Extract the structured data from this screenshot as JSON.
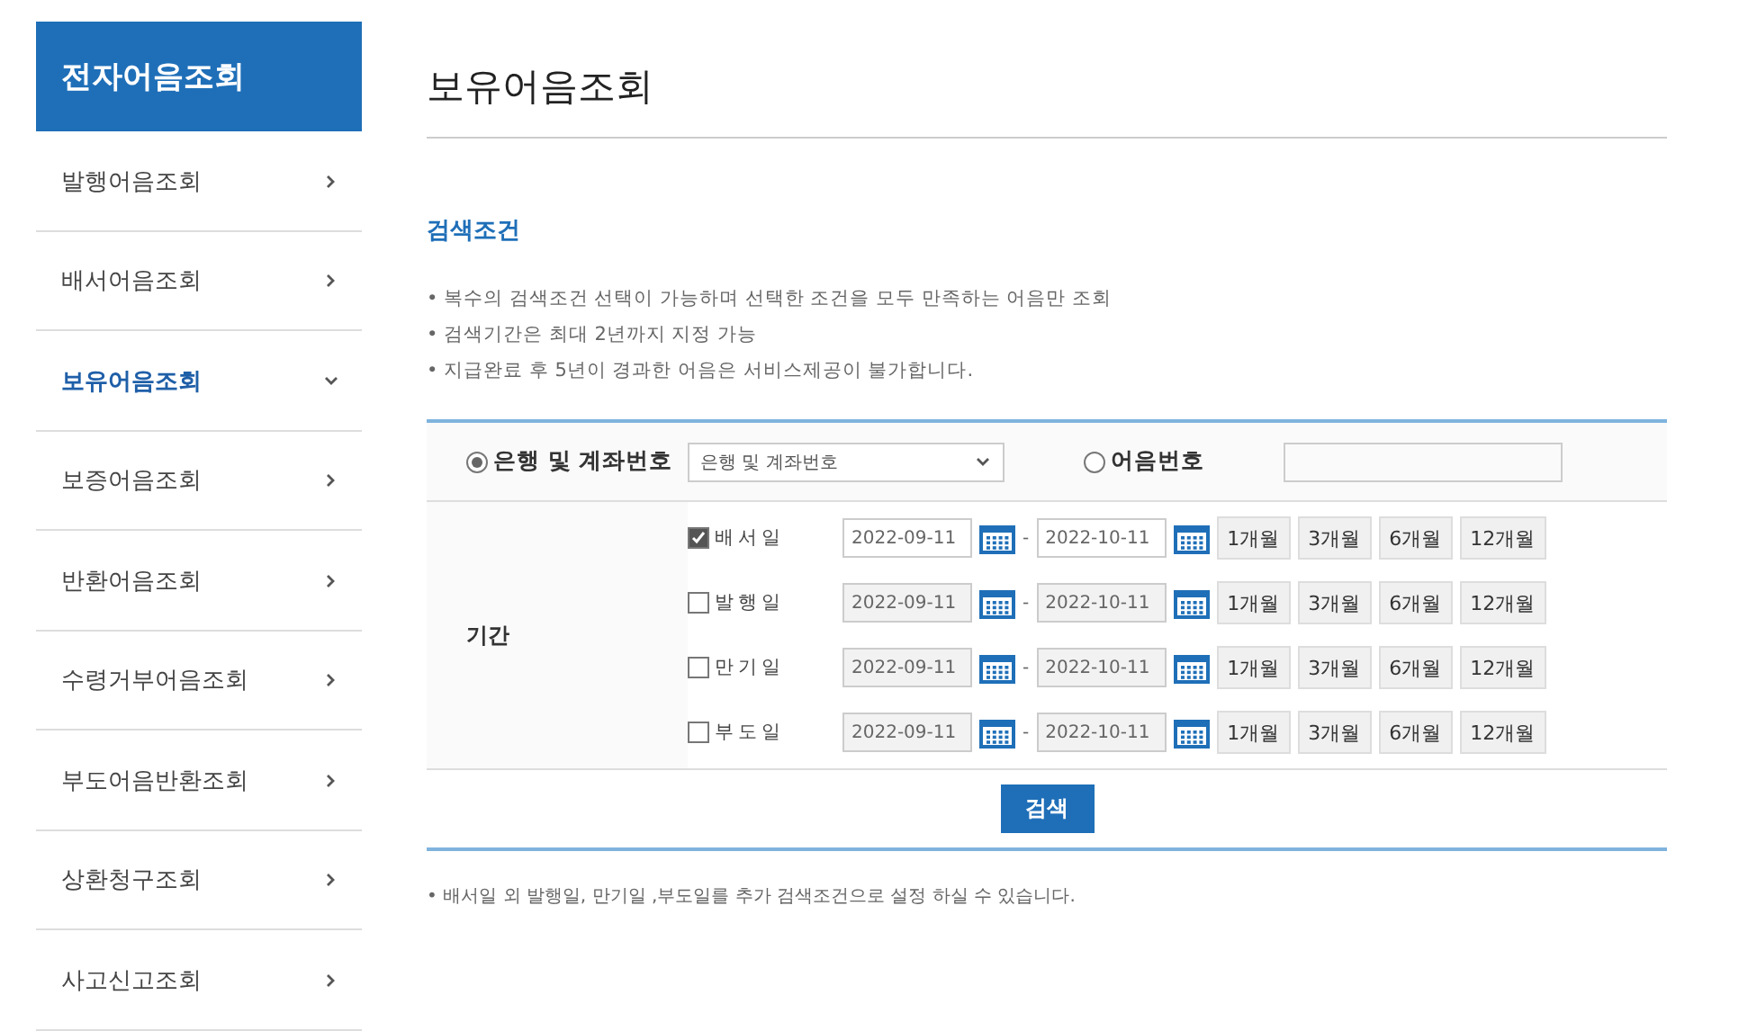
{
  "sidebar": {
    "title": "전자어음조회",
    "items": [
      {
        "label": "발행어음조회",
        "selected": false
      },
      {
        "label": "배서어음조회",
        "selected": false
      },
      {
        "label": "보유어음조회",
        "selected": true
      },
      {
        "label": "보증어음조회",
        "selected": false
      },
      {
        "label": "반환어음조회",
        "selected": false
      },
      {
        "label": "수령거부어음조회",
        "selected": false
      },
      {
        "label": "부도어음반환조회",
        "selected": false
      },
      {
        "label": "상환청구조회",
        "selected": false
      },
      {
        "label": "사고신고조회",
        "selected": false
      }
    ]
  },
  "page_title": "보유어음조회",
  "section_title": "검색조건",
  "notes": [
    "• 복수의 검색조건 선택이 가능하며 선택한 조건을 모두 만족하는 어음만 조회",
    "• 검색기간은 최대 2년까지 지정 가능",
    "• 지급완료 후 5년이 경과한 어음은 서비스제공이 불가합니다."
  ],
  "search_type": [
    {
      "label": "은행 및 계좌번호",
      "selected": true
    },
    {
      "label": "어음번호",
      "selected": false
    }
  ],
  "bank_select": {
    "value": "은행 및 계좌번호"
  },
  "period": {
    "label": "기간",
    "separator": "-",
    "rows": [
      {
        "label": "배서일",
        "checked": true,
        "from": "2022-09-11",
        "to": "2022-10-11",
        "presets": [
          "1개월",
          "3개월",
          "6개월",
          "12개월"
        ]
      },
      {
        "label": "발행일",
        "checked": false,
        "from": "2022-09-11",
        "to": "2022-10-11",
        "presets": [
          "1개월",
          "3개월",
          "6개월",
          "12개월"
        ]
      },
      {
        "label": "만기일",
        "checked": false,
        "from": "2022-09-11",
        "to": "2022-10-11",
        "presets": [
          "1개월",
          "3개월",
          "6개월",
          "12개월"
        ]
      },
      {
        "label": "부도일",
        "checked": false,
        "from": "2022-09-11",
        "to": "2022-10-11",
        "presets": [
          "1개월",
          "3개월",
          "6개월",
          "12개월"
        ]
      }
    ]
  },
  "search_button": "검색",
  "footnote": "• 배서일 외 발행일, 만기일 ,부도일를 추가 검색조건으로 설정 하실 수 있습니다."
}
